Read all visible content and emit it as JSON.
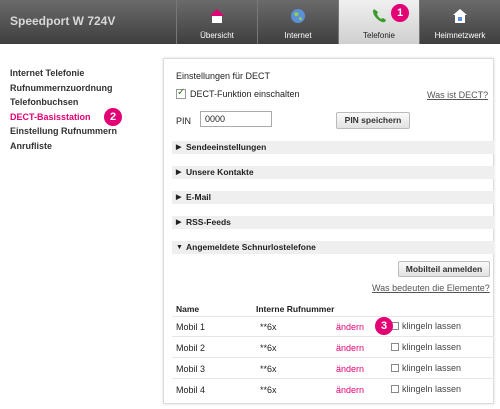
{
  "header": {
    "brand": "Speedport W 724V",
    "tabs": [
      {
        "label": "Übersicht",
        "icon": "home-icon"
      },
      {
        "label": "Internet",
        "icon": "globe-icon"
      },
      {
        "label": "Telefonie",
        "icon": "phone-icon"
      },
      {
        "label": "Heimnetzwerk",
        "icon": "home-network-icon"
      }
    ],
    "active_tab": "Telefonie"
  },
  "steps": [
    "1",
    "2",
    "3"
  ],
  "sidebar": {
    "items": [
      {
        "label": "Internet Telefonie"
      },
      {
        "label": "Rufnummernzuordnung"
      },
      {
        "label": "Telefonbuchsen"
      },
      {
        "label": "DECT-Basisstation"
      },
      {
        "label": "Einstellung Rufnummern"
      },
      {
        "label": "Anrufliste"
      }
    ],
    "active": "DECT-Basisstation"
  },
  "main": {
    "title": "Einstellungen für DECT",
    "dect_checkbox_label": "DECT-Funktion einschalten",
    "dect_checked": true,
    "help_link": "Was ist DECT?",
    "pin_label": "PIN",
    "pin_value": "0000",
    "pin_save_button": "PIN speichern",
    "sections": [
      {
        "label": "Sendeeinstellungen",
        "expanded": false
      },
      {
        "label": "Unsere Kontakte",
        "expanded": false
      },
      {
        "label": "E-Mail",
        "expanded": false
      },
      {
        "label": "RSS-Feeds",
        "expanded": false
      },
      {
        "label": "Angemeldete Schnurlostelefone",
        "expanded": true
      }
    ],
    "register_button": "Mobilteil anmelden",
    "elements_link": "Was bedeuten die Elemente?",
    "table": {
      "headers": [
        "Name",
        "Interne Rufnummer"
      ],
      "rows": [
        {
          "name": "Mobil 1",
          "number": "**6x",
          "edit": "ändern",
          "ring": "klingeln lassen"
        },
        {
          "name": "Mobil 2",
          "number": "**6x",
          "edit": "ändern",
          "ring": "klingeln lassen"
        },
        {
          "name": "Mobil 3",
          "number": "**6x",
          "edit": "ändern",
          "ring": "klingeln lassen"
        },
        {
          "name": "Mobil 4",
          "number": "**6x",
          "edit": "ändern",
          "ring": "klingeln lassen"
        }
      ]
    }
  },
  "colors": {
    "accent": "#e20074",
    "topbar": "#4a4a4a"
  }
}
